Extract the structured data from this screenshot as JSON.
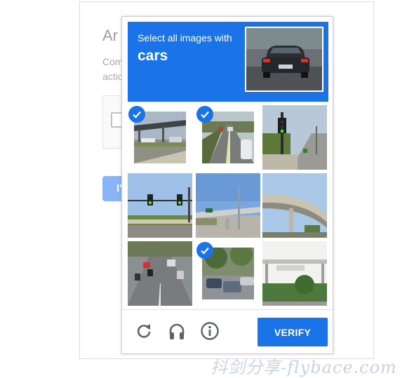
{
  "background": {
    "title": "Ar",
    "text_line1": "Com",
    "text_line2": "actio",
    "button_label": "I'"
  },
  "captcha": {
    "instruction": "Select all images with",
    "target": "cars",
    "tiles": [
      {
        "scene": "carport with parked cars",
        "selected": true
      },
      {
        "scene": "road with cars",
        "selected": true
      },
      {
        "scene": "traffic light by sidewalk",
        "selected": false
      },
      {
        "scene": "traffic lights over road",
        "selected": false
      },
      {
        "scene": "highway overpass",
        "selected": false
      },
      {
        "scene": "curved overpass",
        "selected": false
      },
      {
        "scene": "busy street with motorbikes",
        "selected": false
      },
      {
        "scene": "parked cars under trees",
        "selected": true
      },
      {
        "scene": "overhead sign gantry",
        "selected": false
      }
    ],
    "footer": {
      "reload_icon": "reload-icon",
      "audio_icon": "headphones-icon",
      "info_icon": "info-icon",
      "verify_label": "VERIFY"
    }
  },
  "watermark": "抖剑分享-flybace.com",
  "colors": {
    "accent": "#1a73e8",
    "icon_gray": "#5f6368"
  }
}
